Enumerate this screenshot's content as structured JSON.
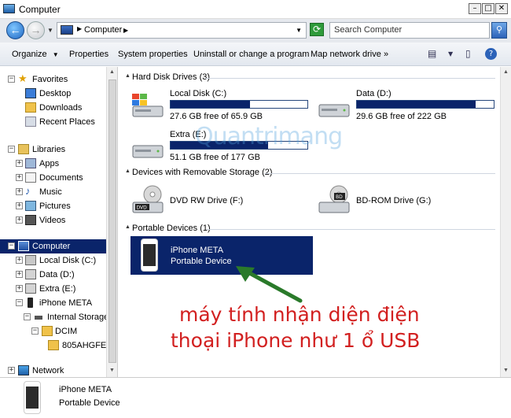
{
  "window": {
    "title": "Computer"
  },
  "address": {
    "location": "Computer",
    "search_placeholder": "Search Computer"
  },
  "toolbar": {
    "organize": "Organize",
    "properties": "Properties",
    "system_properties": "System properties",
    "uninstall": "Uninstall or change a program",
    "map_drive": "Map network drive",
    "more": "»"
  },
  "nav": {
    "favorites": "Favorites",
    "desktop": "Desktop",
    "downloads": "Downloads",
    "recent": "Recent Places",
    "libraries": "Libraries",
    "apps": "Apps",
    "documents": "Documents",
    "music": "Music",
    "pictures": "Pictures",
    "videos": "Videos",
    "computer": "Computer",
    "local_disk": "Local Disk (C:)",
    "data": "Data (D:)",
    "extra": "Extra (E:)",
    "iphone": "iPhone META",
    "internal_storage": "Internal Storage",
    "dcim": "DCIM",
    "folder": "805AHGFE",
    "network": "Network"
  },
  "groups": {
    "hdd": "Hard Disk Drives (3)",
    "removable": "Devices with Removable Storage (2)",
    "portable": "Portable Devices (1)"
  },
  "drives": [
    {
      "name": "Local Disk (C:)",
      "free": "27.6 GB free of 65.9 GB",
      "used_fraction": 0.58
    },
    {
      "name": "Data (D:)",
      "free": "29.6 GB free of 222 GB",
      "used_fraction": 0.87
    },
    {
      "name": "Extra (E:)",
      "free": "51.1 GB free of 177 GB",
      "used_fraction": 0.71
    }
  ],
  "removable": [
    {
      "name": "DVD RW Drive (F:)",
      "badge": "DVD"
    },
    {
      "name": "BD-ROM Drive (G:)",
      "badge": "BD"
    }
  ],
  "device": {
    "name": "iPhone META",
    "type": "Portable Device"
  },
  "watermark": "Quantrimang",
  "annotation": {
    "line1": "máy tính nhận diện điện",
    "line2": "thoại iPhone như 1 ổ USB"
  },
  "details": {
    "name": "iPhone META",
    "type": "Portable Device"
  },
  "colors": {
    "selection": "#0a246a",
    "annotation": "#d22020",
    "arrow": "#2a7a2a"
  }
}
